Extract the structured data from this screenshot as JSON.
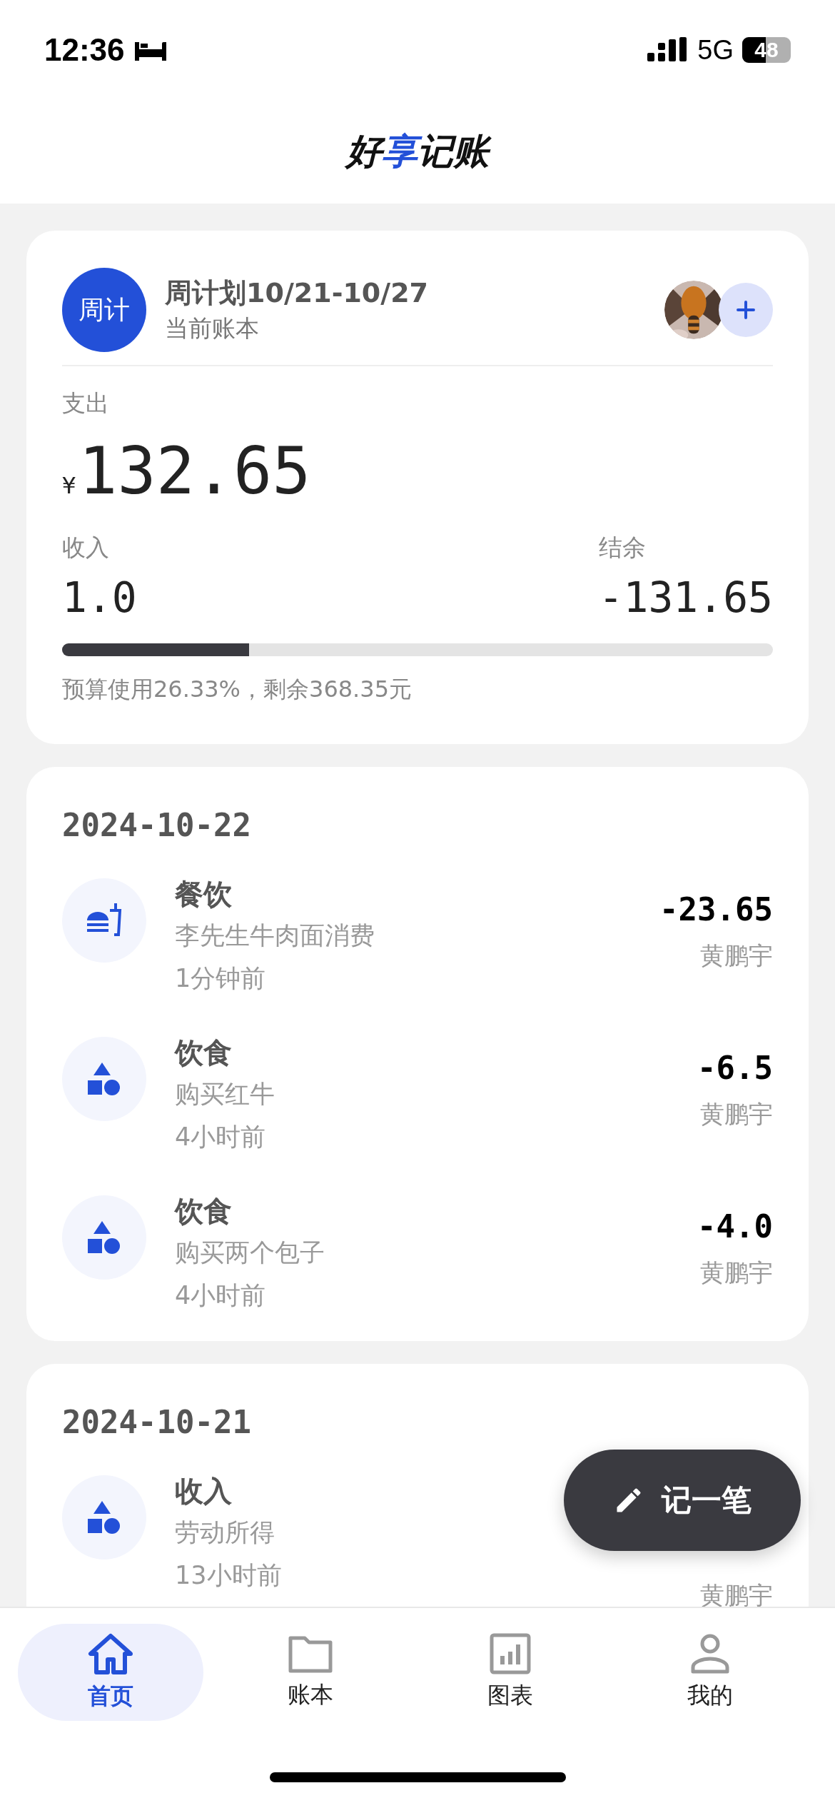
{
  "status_bar": {
    "time": "12:36",
    "network": "5G",
    "battery": "48"
  },
  "header": {
    "title": [
      {
        "text": "好",
        "accent": false
      },
      {
        "text": "享",
        "accent": true
      },
      {
        "text": "记账",
        "accent": false
      }
    ]
  },
  "ledger": {
    "badge": "周计",
    "name": "周计划10/21-10/27",
    "subtitle": "当前账本"
  },
  "summary": {
    "expense_label": "支出",
    "currency": "¥",
    "expense": "132.65",
    "income_label": "收入",
    "income": "1.0",
    "balance_label": "结余",
    "balance": "-131.65",
    "budget": {
      "level": 0.2633,
      "text": "预算使用26.33%，剩余368.35元"
    }
  },
  "days": [
    {
      "date": "2024-10-22",
      "entries": [
        {
          "kind": "dining",
          "category": "餐饮",
          "note": "李先生牛肉面消费",
          "time": "1分钟前",
          "amount": "-23.65",
          "member": "黄鹏宇"
        },
        {
          "kind": "shapes",
          "category": "饮食",
          "note": "购买红牛",
          "time": "4小时前",
          "amount": "-6.5",
          "member": "黄鹏宇"
        },
        {
          "kind": "shapes",
          "category": "饮食",
          "note": "购买两个包子",
          "time": "4小时前",
          "amount": "-4.0",
          "member": "黄鹏宇"
        }
      ]
    },
    {
      "date": "2024-10-21",
      "entries": [
        {
          "kind": "shapes",
          "category": "收入",
          "note": "劳动所得",
          "time": "13小时前",
          "member": "黄鹏宇"
        }
      ]
    }
  ],
  "fab": {
    "label": "记一笔"
  },
  "tabs": [
    {
      "kind": "home",
      "label": "首页",
      "selected": true
    },
    {
      "kind": "ledger",
      "label": "账本",
      "selected": false
    },
    {
      "kind": "chart",
      "label": "图表",
      "selected": false
    },
    {
      "kind": "profile",
      "label": "我的",
      "selected": false
    }
  ]
}
